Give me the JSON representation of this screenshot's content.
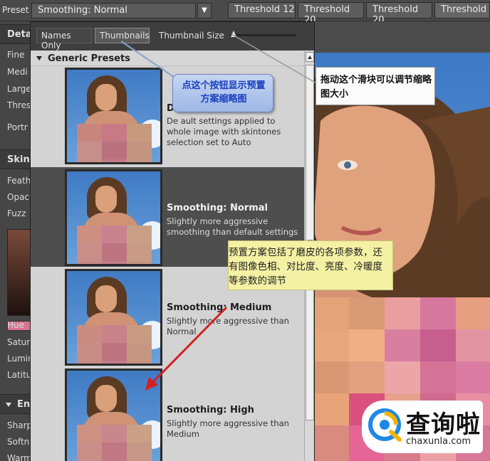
{
  "toolbar": {
    "preset_label": "Preset",
    "preset_value": "Smoothing: Normal",
    "tabs": [
      "Threshold 12",
      "Threshold 20",
      "Threshold 20",
      "Threshold"
    ]
  },
  "left_panel": {
    "items_a": [
      "Fine",
      "Medi",
      "Large",
      "Thres"
    ],
    "item_portrait": "Portr",
    "header_detail": "Deta",
    "header_skin": "Skin",
    "items_skin": [
      "Feath",
      "Opac",
      "Fuzz"
    ],
    "items_color": [
      "Hue",
      "Satur",
      "Lumin",
      "Latitu"
    ],
    "header_enhance": "En",
    "items_enhance": [
      "Sharp",
      "Softn",
      "Warm"
    ]
  },
  "dropdown": {
    "names_only": "Names Only",
    "thumbnails": "Thumbnails",
    "thumbnail_size": "Thumbnail Size",
    "thumbnail_size_level": 0.05,
    "group_title": "Generic Presets",
    "presets": [
      {
        "title": "De",
        "desc": "De       ault settings applied to whole image with skintones selection set to Auto",
        "selected": false
      },
      {
        "title": "Smoothing: Normal",
        "desc": "Slightly more aggressive smoothing than default settings",
        "selected": true
      },
      {
        "title": "Smoothing: Medium",
        "desc": "Slightly more aggressive than Normal",
        "selected": false
      },
      {
        "title": "Smoothing: High",
        "desc": "Slightly more aggressive than Medium",
        "selected": false
      }
    ]
  },
  "annotations": {
    "blue": "点这个按钮显示预置方案缩略图",
    "white": "拖动这个滑块可以调节缩略图大小",
    "yellow": "预置方案包括了磨皮的各项参数，还有图像色相、对比度、亮度、冷暖度等参数的调节"
  },
  "watermark": {
    "text": "查询啦",
    "url": "chaxunla.com"
  },
  "colors": {
    "callout_blue_text": "#1a3ec1",
    "arrow": "#d42020",
    "selected_row": "#4e4e4e"
  }
}
